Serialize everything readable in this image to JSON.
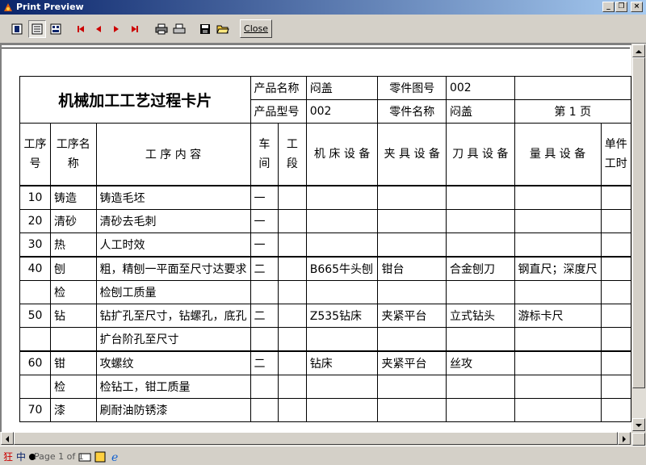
{
  "window": {
    "title": "Print Preview"
  },
  "toolbar": {
    "close_label": "Close"
  },
  "card": {
    "title": "机械加工工艺过程卡片",
    "product_name_label": "产品名称",
    "product_name": "闷盖",
    "part_drawing_label": "零件图号",
    "part_drawing": "002",
    "product_model_label": "产品型号",
    "product_model": "002",
    "part_name_label": "零件名称",
    "part_name": "闷盖",
    "page": "第 1 页",
    "columns": {
      "step_no": "工序号",
      "step_name": "工序名称",
      "content": "工 序 内 容",
      "workshop": "车间",
      "section": "工段",
      "machine": "机 床 设 备",
      "fixture": "夹 具 设 备",
      "tool": "刀 具 设 备",
      "gauge": "量 具 设 备",
      "unit_time": "单件工时"
    },
    "rows": [
      {
        "no": "10",
        "name": "铸造",
        "content": "铸造毛坯",
        "workshop": "一",
        "machine": "",
        "fixture": "",
        "tool": "",
        "gauge": ""
      },
      {
        "no": "20",
        "name": "清砂",
        "content": "清砂去毛刺",
        "workshop": "一",
        "machine": "",
        "fixture": "",
        "tool": "",
        "gauge": ""
      },
      {
        "no": "30",
        "name": "热",
        "content": "人工时效",
        "workshop": "一",
        "machine": "",
        "fixture": "",
        "tool": "",
        "gauge": ""
      },
      {
        "no": "40",
        "name": "刨",
        "content": "粗，精刨一平面至尺寸达要求",
        "workshop": "二",
        "machine": "B665牛头刨",
        "fixture": "钳台",
        "tool": "合金刨刀",
        "gauge": "钢直尺；深度尺"
      },
      {
        "no": "",
        "name": "检",
        "content": "检刨工质量",
        "workshop": "",
        "machine": "",
        "fixture": "",
        "tool": "",
        "gauge": ""
      },
      {
        "no": "50",
        "name": "钻",
        "content": "钻扩孔至尺寸，钻螺孔，底孔",
        "workshop": "二",
        "machine": "Z535钻床",
        "fixture": "夹紧平台",
        "tool": "立式钻头",
        "gauge": "游标卡尺"
      },
      {
        "no": "",
        "name": "",
        "content": "扩台阶孔至尺寸",
        "workshop": "",
        "machine": "",
        "fixture": "",
        "tool": "",
        "gauge": ""
      },
      {
        "no": "60",
        "name": "钳",
        "content": "攻螺纹",
        "workshop": "二",
        "machine": "钻床",
        "fixture": "夹紧平台",
        "tool": "丝攻",
        "gauge": ""
      },
      {
        "no": "",
        "name": "检",
        "content": "检钻工，钳工质量",
        "workshop": "",
        "machine": "",
        "fixture": "",
        "tool": "",
        "gauge": ""
      },
      {
        "no": "70",
        "name": "漆",
        "content": "刷耐油防锈漆",
        "workshop": "",
        "machine": "",
        "fixture": "",
        "tool": "",
        "gauge": ""
      }
    ]
  },
  "status": {
    "page_info": "Page 1 of 1"
  },
  "colors": {
    "titlebar_start": "#0a246a",
    "titlebar_end": "#a6caf0",
    "chrome": "#d4d0c8"
  }
}
